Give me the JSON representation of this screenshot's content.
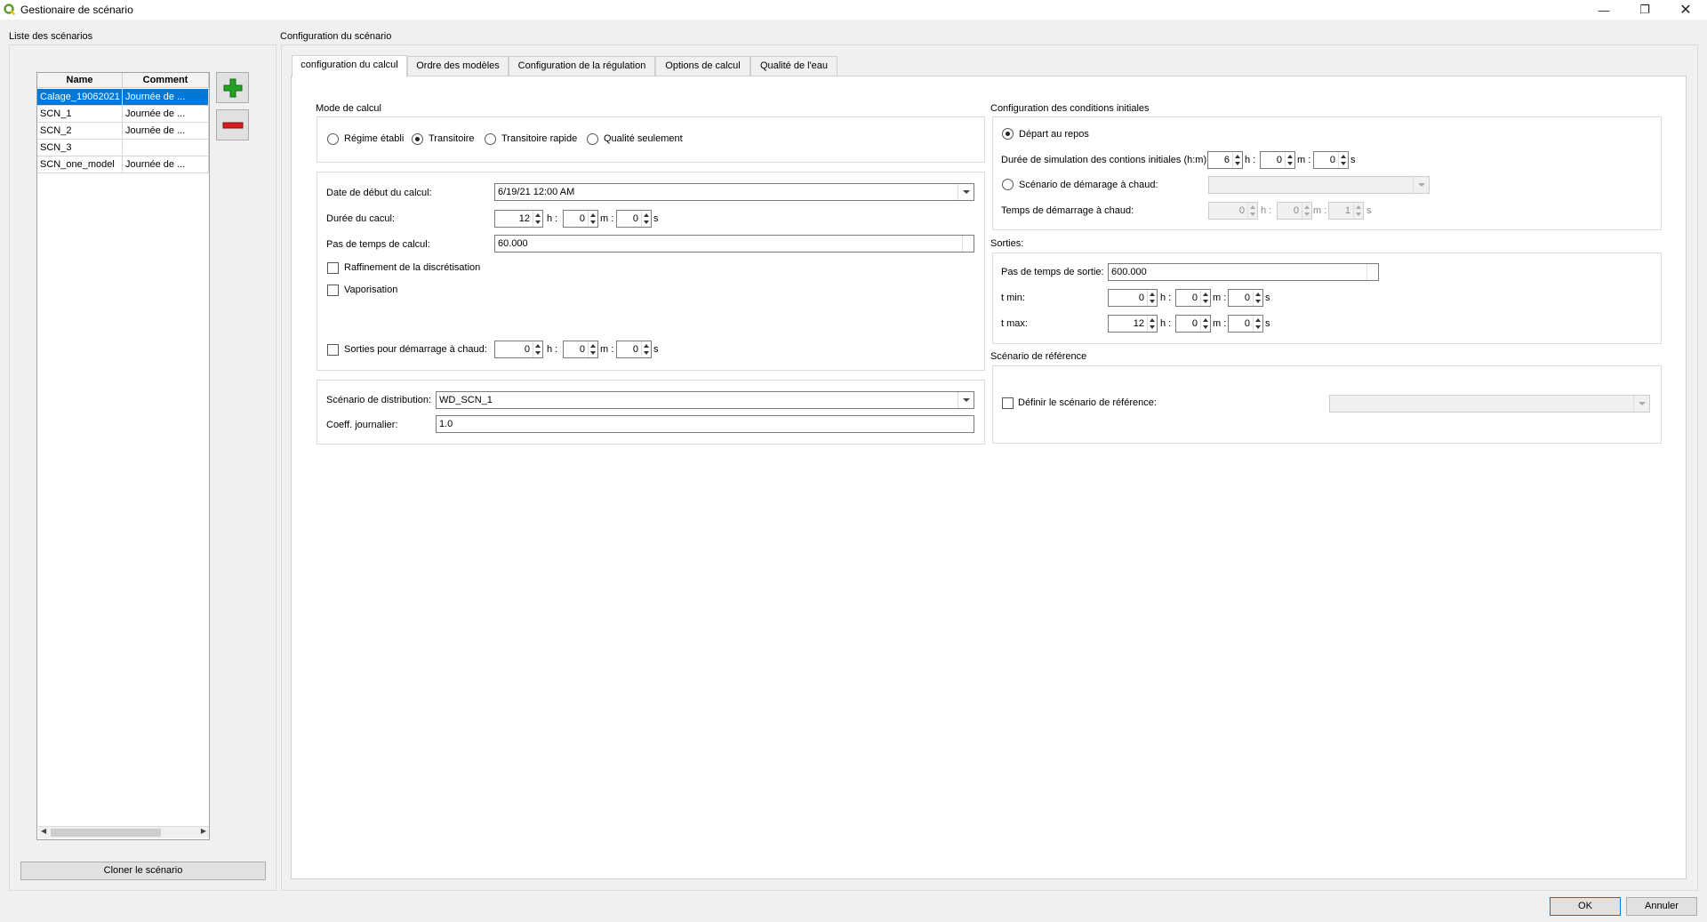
{
  "window": {
    "title": "Gestionaire de scénario"
  },
  "left": {
    "group_title": "Liste des scénarios",
    "columns": [
      "Name",
      "Comment"
    ],
    "rows": [
      {
        "name": "Calage_19062021",
        "comment": "Journée de ..."
      },
      {
        "name": "SCN_1",
        "comment": "Journée de ..."
      },
      {
        "name": "SCN_2",
        "comment": "Journée de ..."
      },
      {
        "name": "SCN_3",
        "comment": ""
      },
      {
        "name": "SCN_one_model",
        "comment": "Journée de ..."
      }
    ],
    "clone_button": "Cloner le scénario"
  },
  "right": {
    "group_title": "Configuration du scénario",
    "tabs": [
      "configuration du calcul",
      "Ordre des modèles",
      "Configuration de la régulation",
      "Options de calcul",
      "Qualité de l'eau"
    ]
  },
  "mode": {
    "title": "Mode de calcul",
    "options": [
      "Régime établi",
      "Transitoire",
      "Transitoire rapide",
      "Qualité seulement"
    ],
    "selected": "Transitoire"
  },
  "calc": {
    "date_label": "Date de début du calcul:",
    "date_value": "6/19/21 12:00 AM",
    "duration_label": "Durée du cacul:",
    "duration": {
      "h": "12",
      "m": "0",
      "s": "0"
    },
    "timestep_label": "Pas de temps de calcul:",
    "timestep_value": "60.000",
    "refine_label": "Raffinement de la discrétisation",
    "vapor_label": "Vaporisation",
    "hotstart_out_label": "Sorties pour démarrage à chaud:",
    "hotstart_out": {
      "h": "0",
      "m": "0",
      "s": "0"
    }
  },
  "units": {
    "h": "h :",
    "m": "m :",
    "s": "s"
  },
  "distribution": {
    "label": "Scénario de distribution:",
    "value": "WD_SCN_1",
    "coeff_label": "Coeff. journalier:",
    "coeff_value": "1.0"
  },
  "initial": {
    "title": "Configuration des conditions initiales",
    "rest_label": "Départ au repos",
    "duration_label": "Durée de simulation des contions initiales (h:m):",
    "duration": {
      "h": "6",
      "m": "0",
      "s": "0"
    },
    "hot_label": "Scénario de démarage à chaud:",
    "hot_time_label": "Temps de démarrage à chaud:",
    "hot_time": {
      "h": "0",
      "m": "0",
      "s": "1"
    }
  },
  "outputs": {
    "title": "Sorties:",
    "step_label": "Pas de temps de sortie:",
    "step_value": "600.000",
    "tmin_label": "t min:",
    "tmin": {
      "h": "0",
      "m": "0",
      "s": "0"
    },
    "tmax_label": "t max:",
    "tmax": {
      "h": "12",
      "m": "0",
      "s": "0"
    }
  },
  "reference": {
    "title": "Scénario de référence",
    "define_label": "Définir le scénario de référence:"
  },
  "footer": {
    "ok": "OK",
    "cancel": "Annuler"
  },
  "colors": {
    "selection": "#0078d7",
    "add": "#22a322",
    "remove": "#d61c1c"
  },
  "icons": [
    "qgis-logo-icon",
    "minimize-icon",
    "restore-icon",
    "close-icon",
    "add-icon",
    "remove-icon"
  ]
}
